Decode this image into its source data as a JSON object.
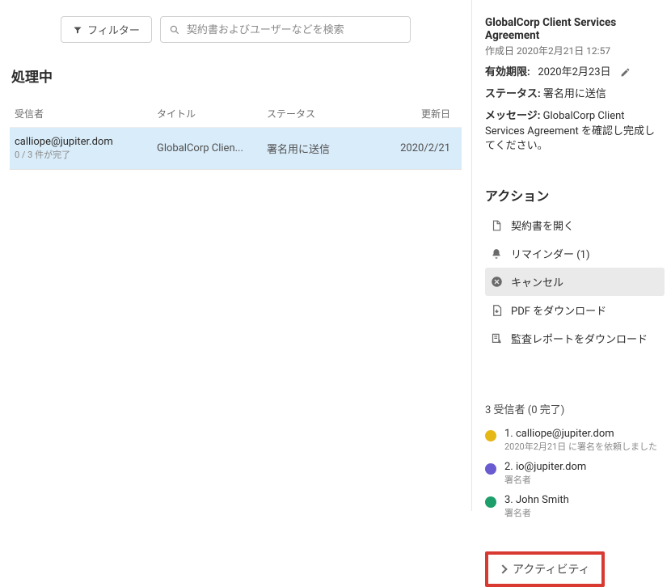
{
  "toolbar": {
    "filter_label": "フィルター",
    "search_placeholder": "契約書およびユーザーなどを検索"
  },
  "section_title": "処理中",
  "columns": {
    "recipient": "受信者",
    "title": "タイトル",
    "status": "ステータス",
    "updated": "更新日"
  },
  "rows": [
    {
      "recipient": "calliope@jupiter.dom",
      "progress": "0 / 3 件が完了",
      "title": "GlobalCorp Clien...",
      "status": "署名用に送信",
      "updated": "2020/2/21"
    }
  ],
  "detail": {
    "title": "GlobalCorp Client Services Agreement",
    "created_label": "作成日",
    "created_value": "2020年2月21日 12:57",
    "expires_label": "有効期限:",
    "expires_value": "2020年2月23日",
    "status_label": "ステータス:",
    "status_value": "署名用に送信",
    "message_label": "メッセージ:",
    "message_value": "GlobalCorp Client Services Agreement を確認し完成してください。"
  },
  "actions": {
    "heading": "アクション",
    "open": "契約書を開く",
    "reminder": "リマインダー (1)",
    "cancel": "キャンセル",
    "download_pdf": "PDF をダウンロード",
    "download_audit": "監査レポートをダウンロード"
  },
  "recipients": {
    "heading": "3 受信者 (0 完了)",
    "items": [
      {
        "label": "1. calliope@jupiter.dom",
        "sub": "2020年2月21日 に署名を依頼しました",
        "color": "#e6b816"
      },
      {
        "label": "2. io@jupiter.dom",
        "sub": "署名者",
        "color": "#6a5cd0"
      },
      {
        "label": "3. John Smith",
        "sub": "署名者",
        "color": "#1e9e6b"
      }
    ]
  },
  "activity_label": "アクティビティ"
}
